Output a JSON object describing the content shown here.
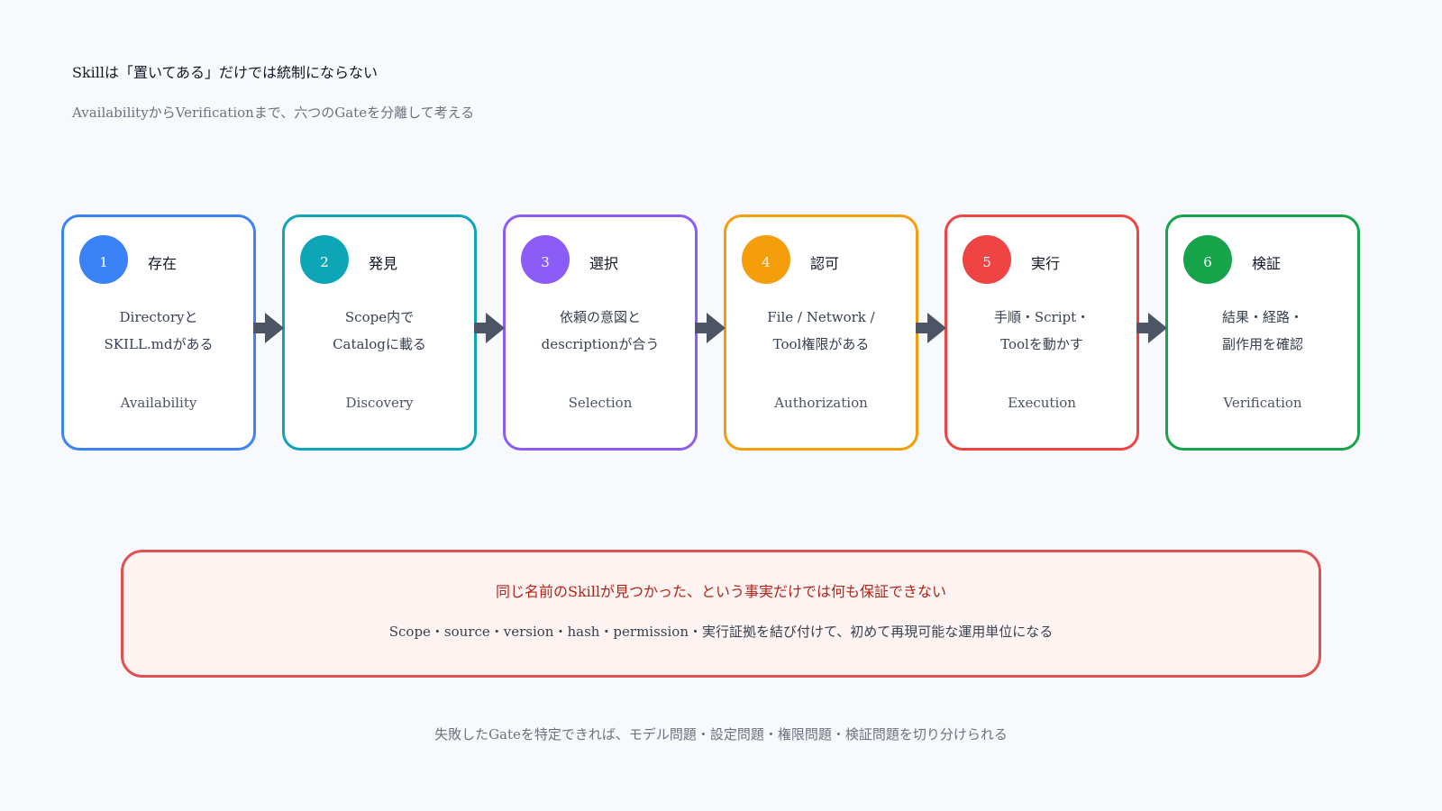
{
  "header": {
    "title": "Skillは「置いてある」だけでは統制にならない",
    "subtitle": "AvailabilityからVerificationまで、六つのGateを分離して考える"
  },
  "gates": [
    {
      "number": "1",
      "name": "存在",
      "desc_line1": "Directoryと",
      "desc_line2": "SKILL.mdがある",
      "en": "Availability",
      "color": "#3b82f6"
    },
    {
      "number": "2",
      "name": "発見",
      "desc_line1": "Scope内で",
      "desc_line2": "Catalogに載る",
      "en": "Discovery",
      "color": "#0ea5b7"
    },
    {
      "number": "3",
      "name": "選択",
      "desc_line1": "依頼の意図と",
      "desc_line2": "descriptionが合う",
      "en": "Selection",
      "color": "#8b5cf6"
    },
    {
      "number": "4",
      "name": "認可",
      "desc_line1": "File / Network /",
      "desc_line2": "Tool権限がある",
      "en": "Authorization",
      "color": "#f59e0b"
    },
    {
      "number": "5",
      "name": "実行",
      "desc_line1": "手順・Script・",
      "desc_line2": "Toolを動かす",
      "en": "Execution",
      "color": "#ef4444"
    },
    {
      "number": "6",
      "name": "検証",
      "desc_line1": "結果・経路・",
      "desc_line2": "副作用を確認",
      "en": "Verification",
      "color": "#16a34a"
    }
  ],
  "colors": {
    "arrow": "#4b5563",
    "callout_border": "#e05252",
    "callout_bg": "#fff4f2",
    "callout_warn_text": "#b42318"
  },
  "callout": {
    "warning": "同じ名前のSkillが見つかった、という事実だけでは何も保証できない",
    "detail": "Scope・source・version・hash・permission・実行証拠を結び付けて、初めて再現可能な運用単位になる"
  },
  "footer": {
    "text": "失敗したGateを特定できれば、モデル問題・設定問題・権限問題・検証問題を切り分けられる"
  }
}
